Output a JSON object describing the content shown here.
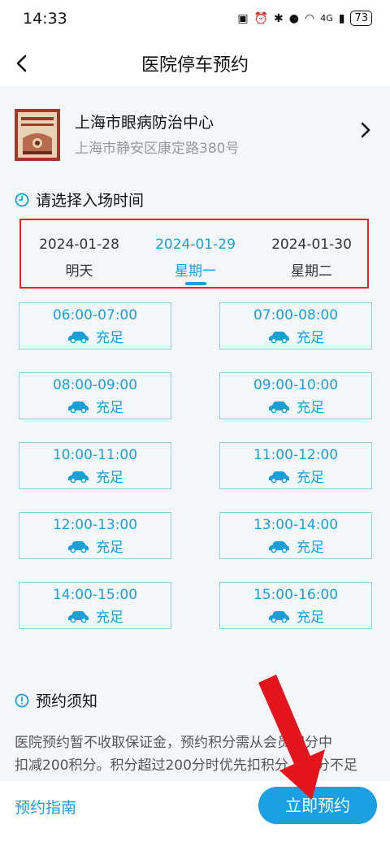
{
  "status_bar": {
    "time": "14:33",
    "network": "4G",
    "battery": "73"
  },
  "header": {
    "title": "医院停车预约"
  },
  "hospital": {
    "name": "上海市眼病防治中心",
    "address": "上海市静安区康定路380号"
  },
  "date_section": {
    "title": "请选择入场时间",
    "dates": [
      {
        "date": "2024-01-28",
        "weekday": "明天",
        "selected": false
      },
      {
        "date": "2024-01-29",
        "weekday": "星期一",
        "selected": true
      },
      {
        "date": "2024-01-30",
        "weekday": "星期二",
        "selected": false
      }
    ]
  },
  "slots": [
    {
      "time": "06:00-07:00",
      "status": "充足"
    },
    {
      "time": "07:00-08:00",
      "status": "充足"
    },
    {
      "time": "08:00-09:00",
      "status": "充足"
    },
    {
      "time": "09:00-10:00",
      "status": "充足"
    },
    {
      "time": "10:00-11:00",
      "status": "充足"
    },
    {
      "time": "11:00-12:00",
      "status": "充足"
    },
    {
      "time": "12:00-13:00",
      "status": "充足"
    },
    {
      "time": "13:00-14:00",
      "status": "充足"
    },
    {
      "time": "14:00-15:00",
      "status": "充足"
    },
    {
      "time": "15:00-16:00",
      "status": "充足"
    }
  ],
  "notice": {
    "title": "预约须知",
    "line1": "医院预约暂不收取保证金，预约积分需从会员积分中",
    "line2": "扣减200积分。积分超过200分时优先扣积分，积分不足"
  },
  "bottom": {
    "guide_label": "预约指南",
    "book_label": "立即预约"
  },
  "colors": {
    "accent": "#1a9fd9",
    "button": "#1ca0e3",
    "highlight_box": "#e32530",
    "arrow": "#e3141c"
  }
}
